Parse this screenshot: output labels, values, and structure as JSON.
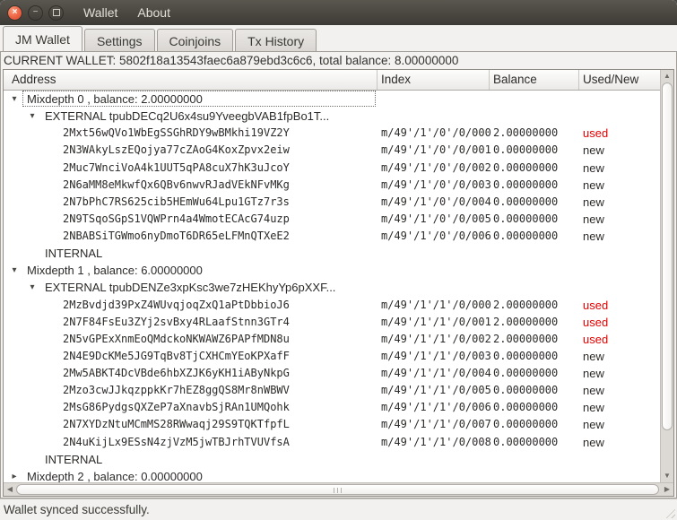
{
  "window": {
    "menu_items": [
      "Wallet",
      "About"
    ],
    "icons": {
      "close": "×",
      "minimize": "−",
      "maximize": "▢"
    }
  },
  "tabs": {
    "items": [
      {
        "label": "JM Wallet",
        "active": true
      },
      {
        "label": "Settings",
        "active": false
      },
      {
        "label": "Coinjoins",
        "active": false
      },
      {
        "label": "Tx History",
        "active": false
      }
    ]
  },
  "wallet_bar": {
    "text": "CURRENT WALLET: 5802f18a13543faec6a879ebd3c6c6, total balance: 8.00000000"
  },
  "tree": {
    "columns": [
      "Address",
      "Index",
      "Balance",
      "Used/New"
    ],
    "rows": [
      {
        "level": 0,
        "state": "expanded",
        "label": "Mixdepth 0 , balance: 2.00000000",
        "focused": true
      },
      {
        "level": 1,
        "state": "expanded",
        "label": "EXTERNAL tpubDECq2U6x4su9YveegbVAB1fpBo1T..."
      },
      {
        "level": 2,
        "label": "2Mxt56wQVo1WbEgSSGhRDY9wBMkhi19VZ2Y",
        "index": "m/49'/1'/0'/0/000",
        "balance": "2.00000000",
        "status": "used"
      },
      {
        "level": 2,
        "label": "2N3WAkyLszEQojya77cZAoG4KoxZpvx2eiw",
        "index": "m/49'/1'/0'/0/001",
        "balance": "0.00000000",
        "status": "new"
      },
      {
        "level": 2,
        "label": "2Muc7WnciVoA4k1UUT5qPA8cuX7hK3uJcoY",
        "index": "m/49'/1'/0'/0/002",
        "balance": "0.00000000",
        "status": "new"
      },
      {
        "level": 2,
        "label": "2N6aMM8eMkwfQx6QBv6nwvRJadVEkNFvMKg",
        "index": "m/49'/1'/0'/0/003",
        "balance": "0.00000000",
        "status": "new"
      },
      {
        "level": 2,
        "label": "2N7bPhC7RS625cib5HEmWu64Lpu1GTz7r3s",
        "index": "m/49'/1'/0'/0/004",
        "balance": "0.00000000",
        "status": "new"
      },
      {
        "level": 2,
        "label": "2N9TSqoSGpS1VQWPrn4a4WmotECAcG74uzp",
        "index": "m/49'/1'/0'/0/005",
        "balance": "0.00000000",
        "status": "new"
      },
      {
        "level": 2,
        "label": "2NBABSiTGWmo6nyDmoT6DR65eLFMnQTXeE2",
        "index": "m/49'/1'/0'/0/006",
        "balance": "0.00000000",
        "status": "new"
      },
      {
        "level": 1,
        "label": "INTERNAL"
      },
      {
        "level": 0,
        "state": "expanded",
        "label": "Mixdepth 1 , balance: 6.00000000"
      },
      {
        "level": 1,
        "state": "expanded",
        "label": "EXTERNAL tpubDENZe3xpKsc3we7zHEKhyYp6pXXF..."
      },
      {
        "level": 2,
        "label": "2MzBvdjd39PxZ4WUvqjoqZxQ1aPtDbbioJ6",
        "index": "m/49'/1'/1'/0/000",
        "balance": "2.00000000",
        "status": "used"
      },
      {
        "level": 2,
        "label": "2N7F84FsEu3ZYj2svBxy4RLaafStnn3GTr4",
        "index": "m/49'/1'/1'/0/001",
        "balance": "2.00000000",
        "status": "used"
      },
      {
        "level": 2,
        "label": "2N5vGPExXnmEoQMdckoNKWAWZ6PAPfMDN8u",
        "index": "m/49'/1'/1'/0/002",
        "balance": "2.00000000",
        "status": "used"
      },
      {
        "level": 2,
        "label": "2N4E9DcKMe5JG9TqBv8TjCXHCmYEoKPXafF",
        "index": "m/49'/1'/1'/0/003",
        "balance": "0.00000000",
        "status": "new"
      },
      {
        "level": 2,
        "label": "2Mw5ABKT4DcVBde6hbXZJK6yKH1iAByNkpG",
        "index": "m/49'/1'/1'/0/004",
        "balance": "0.00000000",
        "status": "new"
      },
      {
        "level": 2,
        "label": "2Mzo3cwJJkqzppkKr7hEZ8ggQS8Mr8nWBWV",
        "index": "m/49'/1'/1'/0/005",
        "balance": "0.00000000",
        "status": "new"
      },
      {
        "level": 2,
        "label": "2MsG86PydgsQXZeP7aXnavbSjRAn1UMQohk",
        "index": "m/49'/1'/1'/0/006",
        "balance": "0.00000000",
        "status": "new"
      },
      {
        "level": 2,
        "label": "2N7XYDzNtuMCmMS28RWwaqj29S9TQKTfpfL",
        "index": "m/49'/1'/1'/0/007",
        "balance": "0.00000000",
        "status": "new"
      },
      {
        "level": 2,
        "label": "2N4uKijLx9ESsN4zjVzM5jwTBJrhTVUVfsA",
        "index": "m/49'/1'/1'/0/008",
        "balance": "0.00000000",
        "status": "new"
      },
      {
        "level": 1,
        "label": "INTERNAL"
      },
      {
        "level": 0,
        "state": "collapsed",
        "label": "Mixdepth 2 , balance: 0.00000000"
      }
    ]
  },
  "status_bar": {
    "text": "Wallet synced successfully."
  },
  "colors": {
    "used_text": "#e40000",
    "new_text": "#2c2b29",
    "close_button": "#ee6244",
    "titlebar": "#3d3b36"
  }
}
